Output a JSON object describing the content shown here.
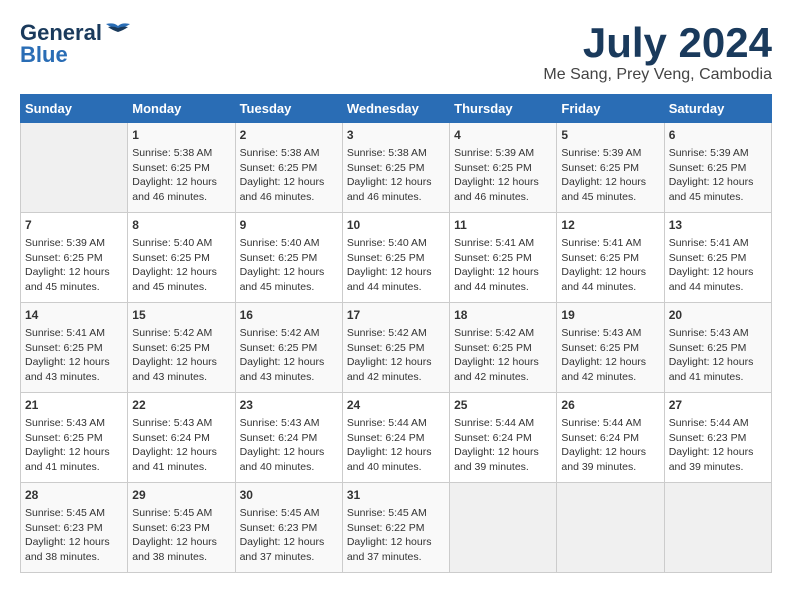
{
  "logo": {
    "line1": "General",
    "line2": "Blue"
  },
  "title": "July 2024",
  "subtitle": "Me Sang, Prey Veng, Cambodia",
  "days_of_week": [
    "Sunday",
    "Monday",
    "Tuesday",
    "Wednesday",
    "Thursday",
    "Friday",
    "Saturday"
  ],
  "weeks": [
    [
      {
        "day": "",
        "info": ""
      },
      {
        "day": "1",
        "info": "Sunrise: 5:38 AM\nSunset: 6:25 PM\nDaylight: 12 hours\nand 46 minutes."
      },
      {
        "day": "2",
        "info": "Sunrise: 5:38 AM\nSunset: 6:25 PM\nDaylight: 12 hours\nand 46 minutes."
      },
      {
        "day": "3",
        "info": "Sunrise: 5:38 AM\nSunset: 6:25 PM\nDaylight: 12 hours\nand 46 minutes."
      },
      {
        "day": "4",
        "info": "Sunrise: 5:39 AM\nSunset: 6:25 PM\nDaylight: 12 hours\nand 46 minutes."
      },
      {
        "day": "5",
        "info": "Sunrise: 5:39 AM\nSunset: 6:25 PM\nDaylight: 12 hours\nand 45 minutes."
      },
      {
        "day": "6",
        "info": "Sunrise: 5:39 AM\nSunset: 6:25 PM\nDaylight: 12 hours\nand 45 minutes."
      }
    ],
    [
      {
        "day": "7",
        "info": "Sunrise: 5:39 AM\nSunset: 6:25 PM\nDaylight: 12 hours\nand 45 minutes."
      },
      {
        "day": "8",
        "info": "Sunrise: 5:40 AM\nSunset: 6:25 PM\nDaylight: 12 hours\nand 45 minutes."
      },
      {
        "day": "9",
        "info": "Sunrise: 5:40 AM\nSunset: 6:25 PM\nDaylight: 12 hours\nand 45 minutes."
      },
      {
        "day": "10",
        "info": "Sunrise: 5:40 AM\nSunset: 6:25 PM\nDaylight: 12 hours\nand 44 minutes."
      },
      {
        "day": "11",
        "info": "Sunrise: 5:41 AM\nSunset: 6:25 PM\nDaylight: 12 hours\nand 44 minutes."
      },
      {
        "day": "12",
        "info": "Sunrise: 5:41 AM\nSunset: 6:25 PM\nDaylight: 12 hours\nand 44 minutes."
      },
      {
        "day": "13",
        "info": "Sunrise: 5:41 AM\nSunset: 6:25 PM\nDaylight: 12 hours\nand 44 minutes."
      }
    ],
    [
      {
        "day": "14",
        "info": "Sunrise: 5:41 AM\nSunset: 6:25 PM\nDaylight: 12 hours\nand 43 minutes."
      },
      {
        "day": "15",
        "info": "Sunrise: 5:42 AM\nSunset: 6:25 PM\nDaylight: 12 hours\nand 43 minutes."
      },
      {
        "day": "16",
        "info": "Sunrise: 5:42 AM\nSunset: 6:25 PM\nDaylight: 12 hours\nand 43 minutes."
      },
      {
        "day": "17",
        "info": "Sunrise: 5:42 AM\nSunset: 6:25 PM\nDaylight: 12 hours\nand 42 minutes."
      },
      {
        "day": "18",
        "info": "Sunrise: 5:42 AM\nSunset: 6:25 PM\nDaylight: 12 hours\nand 42 minutes."
      },
      {
        "day": "19",
        "info": "Sunrise: 5:43 AM\nSunset: 6:25 PM\nDaylight: 12 hours\nand 42 minutes."
      },
      {
        "day": "20",
        "info": "Sunrise: 5:43 AM\nSunset: 6:25 PM\nDaylight: 12 hours\nand 41 minutes."
      }
    ],
    [
      {
        "day": "21",
        "info": "Sunrise: 5:43 AM\nSunset: 6:25 PM\nDaylight: 12 hours\nand 41 minutes."
      },
      {
        "day": "22",
        "info": "Sunrise: 5:43 AM\nSunset: 6:24 PM\nDaylight: 12 hours\nand 41 minutes."
      },
      {
        "day": "23",
        "info": "Sunrise: 5:43 AM\nSunset: 6:24 PM\nDaylight: 12 hours\nand 40 minutes."
      },
      {
        "day": "24",
        "info": "Sunrise: 5:44 AM\nSunset: 6:24 PM\nDaylight: 12 hours\nand 40 minutes."
      },
      {
        "day": "25",
        "info": "Sunrise: 5:44 AM\nSunset: 6:24 PM\nDaylight: 12 hours\nand 39 minutes."
      },
      {
        "day": "26",
        "info": "Sunrise: 5:44 AM\nSunset: 6:24 PM\nDaylight: 12 hours\nand 39 minutes."
      },
      {
        "day": "27",
        "info": "Sunrise: 5:44 AM\nSunset: 6:23 PM\nDaylight: 12 hours\nand 39 minutes."
      }
    ],
    [
      {
        "day": "28",
        "info": "Sunrise: 5:45 AM\nSunset: 6:23 PM\nDaylight: 12 hours\nand 38 minutes."
      },
      {
        "day": "29",
        "info": "Sunrise: 5:45 AM\nSunset: 6:23 PM\nDaylight: 12 hours\nand 38 minutes."
      },
      {
        "day": "30",
        "info": "Sunrise: 5:45 AM\nSunset: 6:23 PM\nDaylight: 12 hours\nand 37 minutes."
      },
      {
        "day": "31",
        "info": "Sunrise: 5:45 AM\nSunset: 6:22 PM\nDaylight: 12 hours\nand 37 minutes."
      },
      {
        "day": "",
        "info": ""
      },
      {
        "day": "",
        "info": ""
      },
      {
        "day": "",
        "info": ""
      }
    ]
  ]
}
